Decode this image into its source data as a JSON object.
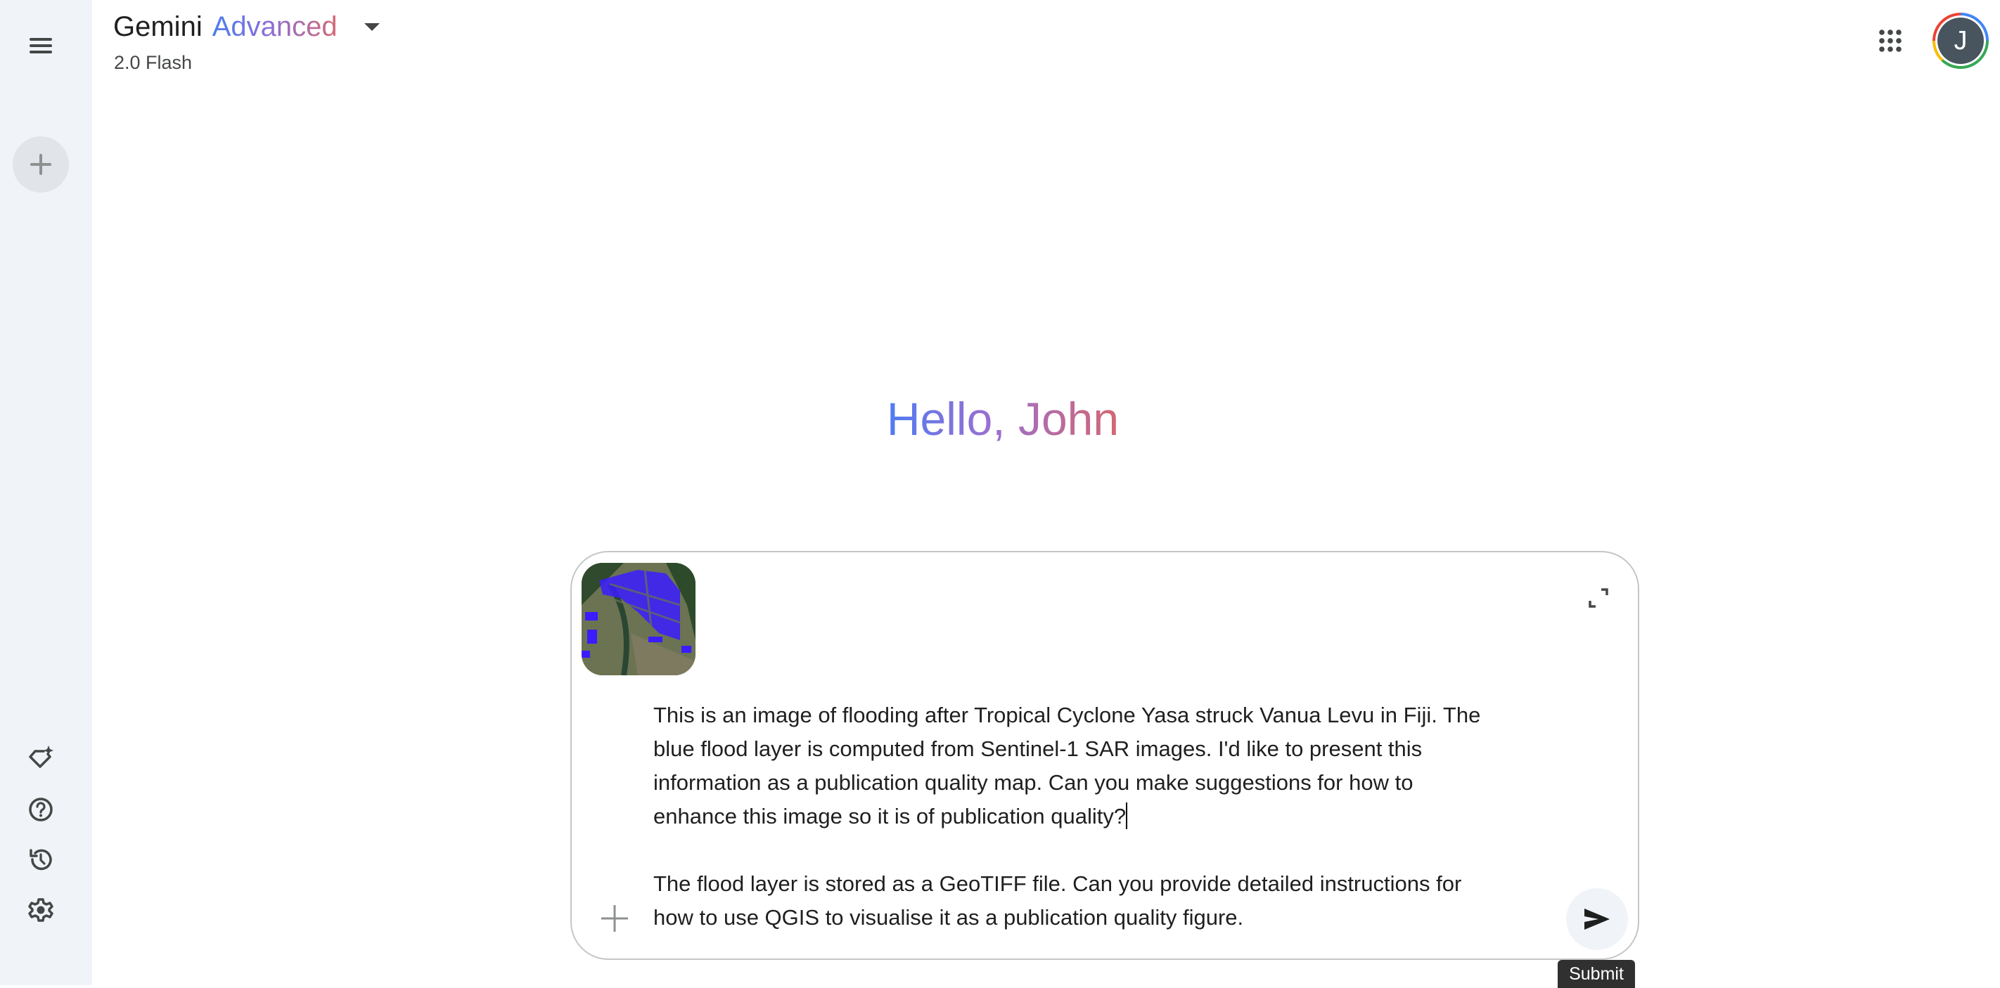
{
  "header": {
    "title_main": "Gemini",
    "title_accent": "Advanced",
    "model": "2.0 Flash",
    "avatar_initial": "J"
  },
  "greeting": "Hello, John",
  "composer": {
    "paragraphs": [
      [
        "This is an image of flooding after Tropical Cyclone Yasa struck Vanua Levu in Fiji. The",
        "blue flood layer is computed from Sentinel-1 SAR images. I'd like to present this",
        "information as a publication quality map. Can you make suggestions for how to",
        "enhance this image so it is of publication quality?"
      ],
      [
        "The flood layer is stored as a GeoTIFF file. Can you provide detailed instructions for",
        "how to use QGIS to visualise it as a publication quality figure."
      ]
    ],
    "tooltip": "Submit"
  },
  "icons": {
    "menu": "menu-icon",
    "new_chat": "plus-icon",
    "gems": "gem-sparkle-icon",
    "help": "help-icon",
    "activity": "history-icon",
    "settings": "gear-icon",
    "apps": "apps-grid-icon",
    "expand": "expand-icon",
    "add": "plus-icon",
    "send": "send-icon"
  },
  "colors": {
    "sidebar_bg": "#f0f4f9",
    "accent_blue": "#4b7cf0",
    "accent_red": "#d46a73",
    "flood_blue": "#3a1cff"
  }
}
